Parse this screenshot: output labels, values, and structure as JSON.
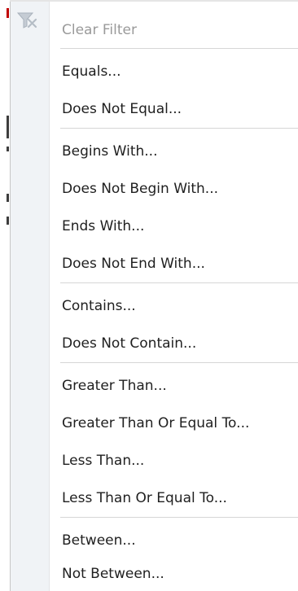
{
  "menu": {
    "clear_filter": {
      "label": "Clear Filter",
      "icon": "clear-filter-icon",
      "enabled": false
    },
    "items": [
      {
        "label": "Equals..."
      },
      {
        "label": "Does Not Equal..."
      },
      {
        "label": "Begins With..."
      },
      {
        "label": "Does Not Begin With..."
      },
      {
        "label": "Ends With..."
      },
      {
        "label": "Does Not End With..."
      },
      {
        "label": "Contains..."
      },
      {
        "label": "Does Not Contain..."
      },
      {
        "label": "Greater Than..."
      },
      {
        "label": "Greater Than Or Equal To..."
      },
      {
        "label": "Less Than..."
      },
      {
        "label": "Less Than Or Equal To..."
      },
      {
        "label": "Between..."
      },
      {
        "label": "Not Between..."
      }
    ]
  },
  "colors": {
    "gutter": "#f0f3f6",
    "text": "#1f1f1f",
    "disabled_text": "#9a9a9a",
    "separator": "#d6d6d6"
  }
}
